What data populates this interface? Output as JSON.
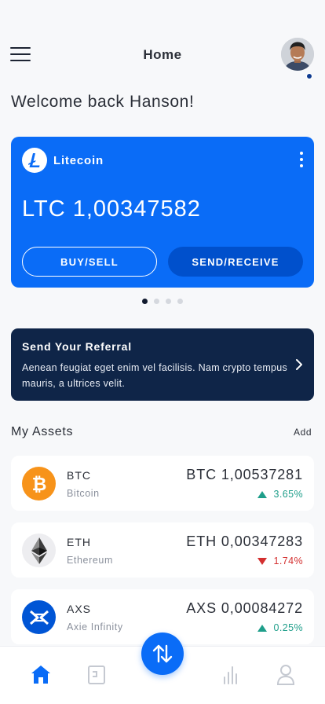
{
  "header": {
    "title": "Home",
    "menu_icon": "hamburger-menu-icon",
    "has_notification": true
  },
  "welcome": "Welcome back Hanson!",
  "wallet_card": {
    "coin_name": "Litecoin",
    "coin_icon": "litecoin-icon",
    "balance": "LTC 1,00347582",
    "buy_label": "BUY/SELL",
    "send_label": "SEND/RECEIVE",
    "color": "#0a6cf7"
  },
  "carousel": {
    "count": 4,
    "active": 1
  },
  "referral": {
    "title": "Send Your Referral",
    "text": "Aenean feugiat eget enim vel facilisis. Nam crypto tempus mauris, a ultrices velit.",
    "color": "#0f2548"
  },
  "assets": {
    "title": "My Assets",
    "add_label": "Add",
    "items": [
      {
        "symbol": "BTC",
        "name": "Bitcoin",
        "amount": "BTC 1,00537281",
        "change": "3.65%",
        "direction": "up",
        "icon": "bitcoin-icon",
        "color": "#f7931a"
      },
      {
        "symbol": "ETH",
        "name": "Ethereum",
        "amount": "ETH 0,00347283",
        "change": "1.74%",
        "direction": "down",
        "icon": "ethereum-icon",
        "color": "#ededf0"
      },
      {
        "symbol": "AXS",
        "name": "Axie Infinity",
        "amount": "AXS 0,00084272",
        "change": "0.25%",
        "direction": "up",
        "icon": "axie-infinity-icon",
        "color": "#0055d5"
      }
    ]
  },
  "tabbar": {
    "tabs": [
      "home-icon",
      "wallet-icon",
      "chart-icon",
      "profile-icon"
    ],
    "active": "home-icon",
    "fab_icon": "swap-arrows-icon",
    "accent": "#0a6cf7"
  }
}
